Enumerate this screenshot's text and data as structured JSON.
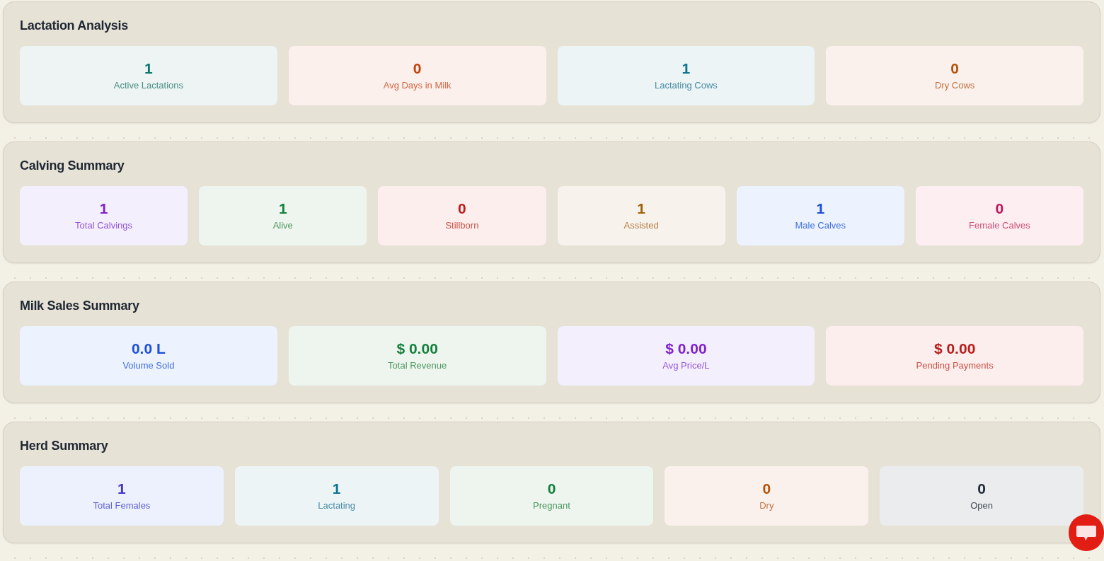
{
  "sections": [
    {
      "title": "Lactation Analysis",
      "stats": [
        {
          "value": "1",
          "label": "Active Lactations",
          "color": "#0f766e"
        },
        {
          "value": "0",
          "label": "Avg Days in Milk",
          "color": "#c2410c"
        },
        {
          "value": "1",
          "label": "Lactating Cows",
          "color": "#0e7490"
        },
        {
          "value": "0",
          "label": "Dry Cows",
          "color": "#b45309"
        }
      ]
    },
    {
      "title": "Calving Summary",
      "stats": [
        {
          "value": "1",
          "label": "Total Calvings",
          "color": "#7e22ce"
        },
        {
          "value": "1",
          "label": "Alive",
          "color": "#15803d"
        },
        {
          "value": "0",
          "label": "Stillborn",
          "color": "#b91c1c"
        },
        {
          "value": "1",
          "label": "Assisted",
          "color": "#a16207"
        },
        {
          "value": "1",
          "label": "Male Calves",
          "color": "#1d4ed8"
        },
        {
          "value": "0",
          "label": "Female Calves",
          "color": "#be185d"
        }
      ]
    },
    {
      "title": "Milk Sales Summary",
      "stats": [
        {
          "value": "0.0 L",
          "label": "Volume Sold",
          "color": "#1d4ed8"
        },
        {
          "value": "$ 0.00",
          "label": "Total Revenue",
          "color": "#15803d"
        },
        {
          "value": "$ 0.00",
          "label": "Avg Price/L",
          "color": "#7e22ce"
        },
        {
          "value": "$ 0.00",
          "label": "Pending Payments",
          "color": "#b91c1c"
        }
      ]
    },
    {
      "title": "Herd Summary",
      "stats": [
        {
          "value": "1",
          "label": "Total Females",
          "color": "#4338ca"
        },
        {
          "value": "1",
          "label": "Lactating",
          "color": "#0e7490"
        },
        {
          "value": "0",
          "label": "Pregnant",
          "color": "#15803d"
        },
        {
          "value": "0",
          "label": "Dry",
          "color": "#b45309"
        },
        {
          "value": "0",
          "label": "Open",
          "color": "#1f2937"
        }
      ]
    }
  ]
}
